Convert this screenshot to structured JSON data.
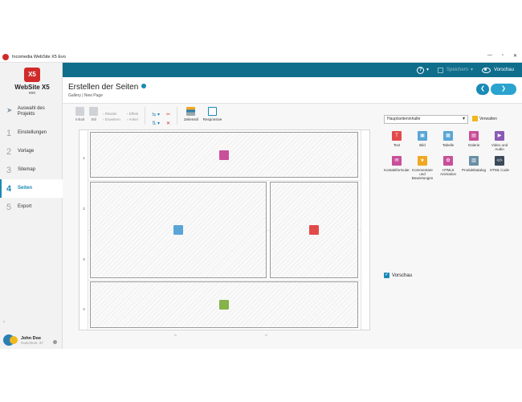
{
  "window": {
    "title": "Incomedia WebSite X5 Evo",
    "controls": {
      "minimize": "—",
      "maximize": "▫",
      "close": "✕"
    }
  },
  "logo": {
    "badge": "X5",
    "name": "WebSite X5",
    "edition": "evo"
  },
  "sidebar": {
    "items": [
      {
        "prefix": "➤",
        "label": "Auswahl des Projekts"
      },
      {
        "prefix": "1",
        "label": "Einstellungen"
      },
      {
        "prefix": "2",
        "label": "Vorlage"
      },
      {
        "prefix": "3",
        "label": "Sitemap"
      },
      {
        "prefix": "4",
        "label": "Seiten"
      },
      {
        "prefix": "5",
        "label": "Export"
      }
    ],
    "collapse": "‹",
    "user": {
      "name": "John Doe",
      "status": "Gutschein: 37"
    }
  },
  "topbar": {
    "help": "?",
    "save_label": "Speichern",
    "preview_label": "Vorschau"
  },
  "header": {
    "title": "Erstellen der Seiten",
    "breadcrumb": "Gallery | New Page",
    "prev": "❮",
    "next": "❯"
  },
  "toolbar": {
    "inhalt": "Inhalt",
    "stil": "Stil",
    "raender": "Ränder",
    "effekt": "Effekt",
    "erweitern": "Erweitern",
    "anker": "Anker",
    "zeilenstil": "Zeilenstil",
    "responsive": "Responsive"
  },
  "grid": {
    "rows": [
      "1",
      "2",
      "3",
      "4"
    ],
    "cells": [
      {
        "name": "cell-row1",
        "icon": "animation-icon",
        "color": "#c94f9a"
      },
      {
        "name": "cell-row2-left",
        "icon": "image-icon",
        "color": "#5aa5d8"
      },
      {
        "name": "cell-row2-right",
        "icon": "text-icon",
        "color": "#e24a4a"
      },
      {
        "name": "cell-row4",
        "icon": "product-icon",
        "color": "#86b24a"
      }
    ]
  },
  "panel": {
    "dropdown_value": "Hauptseiteninhalte",
    "manage_label": "Verwalten",
    "objects": [
      {
        "label": "Text",
        "color": "#e24a4a",
        "glyph": "T"
      },
      {
        "label": "Bild",
        "color": "#5aa5d8",
        "glyph": "▣"
      },
      {
        "label": "Tabelle",
        "color": "#5aa5d8",
        "glyph": "▦"
      },
      {
        "label": "Galerie",
        "color": "#c94f9a",
        "glyph": "▤"
      },
      {
        "label": "Video und Audio",
        "color": "#8a5ab5",
        "glyph": "▶"
      },
      {
        "label": "Kontaktformular",
        "color": "#c94f9a",
        "glyph": "✉"
      },
      {
        "label": "Kommentare und Bewertungen",
        "color": "#f0a823",
        "glyph": "★"
      },
      {
        "label": "HTML5 Animation",
        "color": "#c94f9a",
        "glyph": "✿"
      },
      {
        "label": "Produktkatalog",
        "color": "#6a8fa6",
        "glyph": "▥"
      },
      {
        "label": "HTML Code",
        "color": "#3a4a5a",
        "glyph": "</>"
      }
    ],
    "preview_label": "Vorschau",
    "preview_checked": true
  }
}
